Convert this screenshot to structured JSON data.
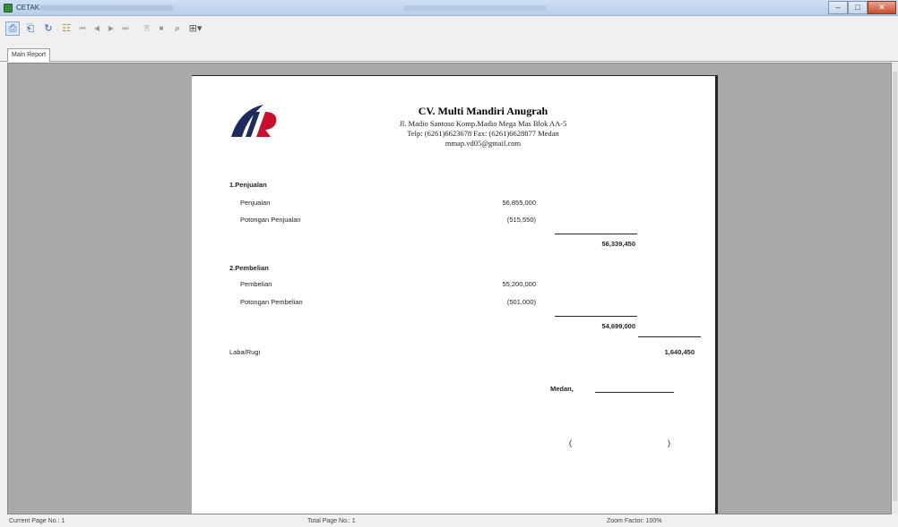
{
  "window": {
    "title": "CETAK"
  },
  "toolbar": {
    "icons": [
      "export-icon",
      "print-setup-icon",
      "refresh-icon",
      "group-tree-icon",
      "first-page-icon",
      "prev-page-icon",
      "next-page-icon",
      "last-page-icon",
      "goto-page-icon",
      "stop-icon",
      "search-icon",
      "zoom-icon"
    ]
  },
  "tabs": [
    {
      "label": "Main Report"
    }
  ],
  "report": {
    "company": "CV. Multi Mandiri Anugrah",
    "address_line1": "Jl. Madio Santoso Komp.Madio Mega Mas Blok AA-5",
    "address_line2": "Telp: (6261)6623678 Fax: (6261)6628877 Medan",
    "address_line3": "mmap.vd05@gmail.com",
    "sections": [
      {
        "heading": "1.Penjualan",
        "rows": [
          {
            "label": "Penjualan",
            "value": "56,855,000"
          },
          {
            "label": "Potongan Penjualan",
            "value": "(515,550)"
          }
        ],
        "subtotal": "56,339,450"
      },
      {
        "heading": "2.Pembelian",
        "rows": [
          {
            "label": "Pembelian",
            "value": "55,200,000"
          },
          {
            "label": "Potongan Pembelian",
            "value": "(501,000)"
          }
        ],
        "subtotal": "54,699,000"
      }
    ],
    "profit_label": "Laba/Rugi",
    "profit_value": "1,640,450",
    "sign_place": "Medan,",
    "sign_open": "(",
    "sign_close": ")"
  },
  "status": {
    "current_page": "Current Page No.: 1",
    "total_pages": "Total Page No.: 1",
    "zoom": "Zoom Factor: 100%"
  },
  "colors": {
    "logo_dark": "#1f2a5c",
    "logo_red": "#c8102e"
  }
}
